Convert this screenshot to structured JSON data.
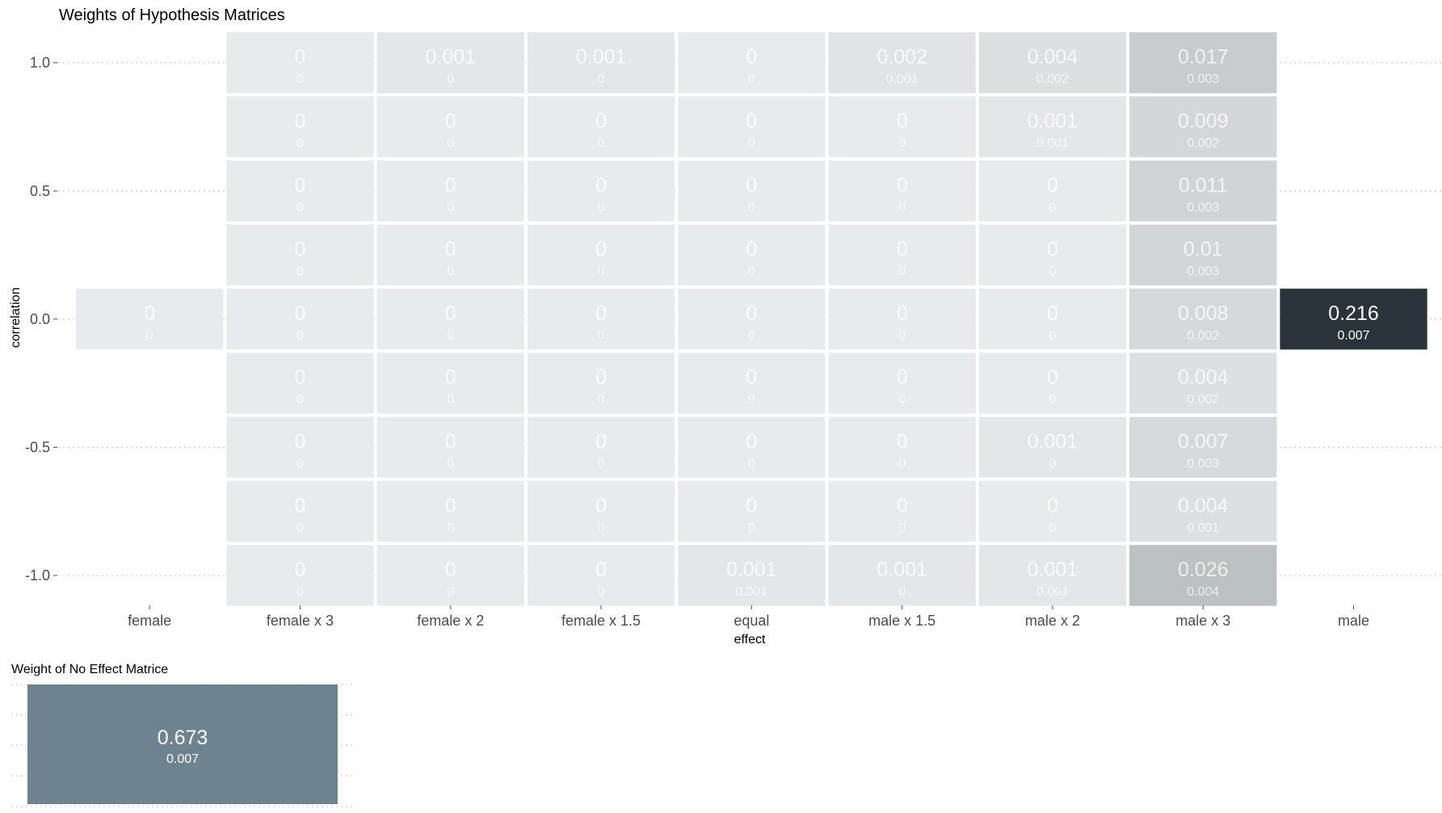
{
  "chart_data": [
    {
      "type": "heatmap",
      "title": "Weights of Hypothesis Matrices",
      "xlabel": "effect",
      "ylabel": "correlation",
      "x_categories": [
        "female",
        "female x 3",
        "female x 2",
        "female x 1.5",
        "equal",
        "male x 1.5",
        "male x 2",
        "male x 3",
        "male"
      ],
      "y_values": [
        1.0,
        0.75,
        0.5,
        0.25,
        0.0,
        -0.25,
        -0.5,
        -0.75,
        -1.0
      ],
      "y_tick_labels": [
        "1.0",
        "0.5",
        "0.0",
        "-0.5",
        "-1.0"
      ],
      "y_tick_values": [
        1.0,
        0.5,
        0.0,
        -0.5,
        -1.0
      ],
      "grid": "dotted horizontal",
      "cells": [
        {
          "x": "female x 3",
          "y": 1.0,
          "value": "0",
          "se": "0"
        },
        {
          "x": "female x 2",
          "y": 1.0,
          "value": "0.001",
          "se": "0"
        },
        {
          "x": "female x 1.5",
          "y": 1.0,
          "value": "0.001",
          "se": "0"
        },
        {
          "x": "equal",
          "y": 1.0,
          "value": "0",
          "se": "0"
        },
        {
          "x": "male x 1.5",
          "y": 1.0,
          "value": "0.002",
          "se": "0.001"
        },
        {
          "x": "male x 2",
          "y": 1.0,
          "value": "0.004",
          "se": "0.002"
        },
        {
          "x": "male x 3",
          "y": 1.0,
          "value": "0.017",
          "se": "0.003"
        },
        {
          "x": "female x 3",
          "y": 0.75,
          "value": "0",
          "se": "0"
        },
        {
          "x": "female x 2",
          "y": 0.75,
          "value": "0",
          "se": "0"
        },
        {
          "x": "female x 1.5",
          "y": 0.75,
          "value": "0",
          "se": "0"
        },
        {
          "x": "equal",
          "y": 0.75,
          "value": "0",
          "se": "0"
        },
        {
          "x": "male x 1.5",
          "y": 0.75,
          "value": "0",
          "se": "0"
        },
        {
          "x": "male x 2",
          "y": 0.75,
          "value": "0.001",
          "se": "0.001"
        },
        {
          "x": "male x 3",
          "y": 0.75,
          "value": "0.009",
          "se": "0.002"
        },
        {
          "x": "female x 3",
          "y": 0.5,
          "value": "0",
          "se": "0"
        },
        {
          "x": "female x 2",
          "y": 0.5,
          "value": "0",
          "se": "0"
        },
        {
          "x": "female x 1.5",
          "y": 0.5,
          "value": "0",
          "se": "0"
        },
        {
          "x": "equal",
          "y": 0.5,
          "value": "0",
          "se": "0"
        },
        {
          "x": "male x 1.5",
          "y": 0.5,
          "value": "0",
          "se": "0"
        },
        {
          "x": "male x 2",
          "y": 0.5,
          "value": "0",
          "se": "0"
        },
        {
          "x": "male x 3",
          "y": 0.5,
          "value": "0.011",
          "se": "0.003"
        },
        {
          "x": "female x 3",
          "y": 0.25,
          "value": "0",
          "se": "0"
        },
        {
          "x": "female x 2",
          "y": 0.25,
          "value": "0",
          "se": "0"
        },
        {
          "x": "female x 1.5",
          "y": 0.25,
          "value": "0",
          "se": "0"
        },
        {
          "x": "equal",
          "y": 0.25,
          "value": "0",
          "se": "0"
        },
        {
          "x": "male x 1.5",
          "y": 0.25,
          "value": "0",
          "se": "0"
        },
        {
          "x": "male x 2",
          "y": 0.25,
          "value": "0",
          "se": "0"
        },
        {
          "x": "male x 3",
          "y": 0.25,
          "value": "0.01",
          "se": "0.003"
        },
        {
          "x": "female",
          "y": 0.0,
          "value": "0",
          "se": "0"
        },
        {
          "x": "female x 3",
          "y": 0.0,
          "value": "0",
          "se": "0"
        },
        {
          "x": "female x 2",
          "y": 0.0,
          "value": "0",
          "se": "0"
        },
        {
          "x": "female x 1.5",
          "y": 0.0,
          "value": "0",
          "se": "0"
        },
        {
          "x": "equal",
          "y": 0.0,
          "value": "0",
          "se": "0"
        },
        {
          "x": "male x 1.5",
          "y": 0.0,
          "value": "0",
          "se": "0"
        },
        {
          "x": "male x 2",
          "y": 0.0,
          "value": "0",
          "se": "0"
        },
        {
          "x": "male x 3",
          "y": 0.0,
          "value": "0.008",
          "se": "0.002"
        },
        {
          "x": "male",
          "y": 0.0,
          "value": "0.216",
          "se": "0.007"
        },
        {
          "x": "female x 3",
          "y": -0.25,
          "value": "0",
          "se": "0"
        },
        {
          "x": "female x 2",
          "y": -0.25,
          "value": "0",
          "se": "0"
        },
        {
          "x": "female x 1.5",
          "y": -0.25,
          "value": "0",
          "se": "0"
        },
        {
          "x": "equal",
          "y": -0.25,
          "value": "0",
          "se": "0"
        },
        {
          "x": "male x 1.5",
          "y": -0.25,
          "value": "0",
          "se": "0"
        },
        {
          "x": "male x 2",
          "y": -0.25,
          "value": "0",
          "se": "0"
        },
        {
          "x": "male x 3",
          "y": -0.25,
          "value": "0.004",
          "se": "0.002"
        },
        {
          "x": "female x 3",
          "y": -0.5,
          "value": "0",
          "se": "0"
        },
        {
          "x": "female x 2",
          "y": -0.5,
          "value": "0",
          "se": "0"
        },
        {
          "x": "female x 1.5",
          "y": -0.5,
          "value": "0",
          "se": "0"
        },
        {
          "x": "equal",
          "y": -0.5,
          "value": "0",
          "se": "0"
        },
        {
          "x": "male x 1.5",
          "y": -0.5,
          "value": "0",
          "se": "0"
        },
        {
          "x": "male x 2",
          "y": -0.5,
          "value": "0.001",
          "se": "0"
        },
        {
          "x": "male x 3",
          "y": -0.5,
          "value": "0.007",
          "se": "0.003"
        },
        {
          "x": "female x 3",
          "y": -0.75,
          "value": "0",
          "se": "0"
        },
        {
          "x": "female x 2",
          "y": -0.75,
          "value": "0",
          "se": "0"
        },
        {
          "x": "female x 1.5",
          "y": -0.75,
          "value": "0",
          "se": "0"
        },
        {
          "x": "equal",
          "y": -0.75,
          "value": "0",
          "se": "0"
        },
        {
          "x": "male x 1.5",
          "y": -0.75,
          "value": "0",
          "se": "0"
        },
        {
          "x": "male x 2",
          "y": -0.75,
          "value": "0",
          "se": "0"
        },
        {
          "x": "male x 3",
          "y": -0.75,
          "value": "0.004",
          "se": "0.001"
        },
        {
          "x": "female x 3",
          "y": -1.0,
          "value": "0",
          "se": "0"
        },
        {
          "x": "female x 2",
          "y": -1.0,
          "value": "0",
          "se": "0"
        },
        {
          "x": "female x 1.5",
          "y": -1.0,
          "value": "0",
          "se": "0"
        },
        {
          "x": "equal",
          "y": -1.0,
          "value": "0.001",
          "se": "0.001"
        },
        {
          "x": "male x 1.5",
          "y": -1.0,
          "value": "0.001",
          "se": "0"
        },
        {
          "x": "male x 2",
          "y": -1.0,
          "value": "0.001",
          "se": "0.001"
        },
        {
          "x": "male x 3",
          "y": -1.0,
          "value": "0.026",
          "se": "0.004"
        }
      ],
      "color_scale": {
        "low": "#e8ebed",
        "high": "#28333a"
      }
    },
    {
      "type": "heatmap",
      "title": "Weight of No Effect Matrice",
      "cells": [
        {
          "value": "0.673",
          "se": "0.007",
          "color": "#6e8390"
        }
      ],
      "grid": "dotted horizontal"
    }
  ]
}
